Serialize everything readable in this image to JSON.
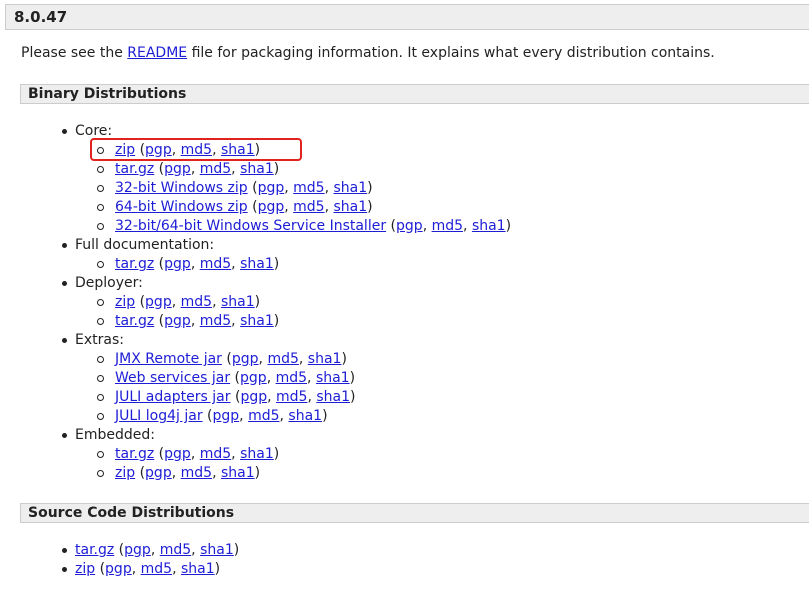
{
  "version": "8.0.47",
  "intro": {
    "prefix": "Please see the ",
    "readme_link": "README",
    "suffix": " file for packaging information. It explains what every distribution contains."
  },
  "binary": {
    "title": "Binary Distributions",
    "groups": [
      {
        "label": "Core:",
        "items": [
          {
            "name": "zip",
            "pgp": "pgp",
            "md5": "md5",
            "sha1": "sha1"
          },
          {
            "name": "tar.gz",
            "pgp": "pgp",
            "md5": "md5",
            "sha1": "sha1"
          },
          {
            "name": "32-bit Windows zip",
            "pgp": "pgp",
            "md5": "md5",
            "sha1": "sha1"
          },
          {
            "name": "64-bit Windows zip",
            "pgp": "pgp",
            "md5": "md5",
            "sha1": "sha1"
          },
          {
            "name": "32-bit/64-bit Windows Service Installer",
            "pgp": "pgp",
            "md5": "md5",
            "sha1": "sha1"
          }
        ]
      },
      {
        "label": "Full documentation:",
        "items": [
          {
            "name": "tar.gz",
            "pgp": "pgp",
            "md5": "md5",
            "sha1": "sha1"
          }
        ]
      },
      {
        "label": "Deployer:",
        "items": [
          {
            "name": "zip",
            "pgp": "pgp",
            "md5": "md5",
            "sha1": "sha1"
          },
          {
            "name": "tar.gz",
            "pgp": "pgp",
            "md5": "md5",
            "sha1": "sha1"
          }
        ]
      },
      {
        "label": "Extras:",
        "items": [
          {
            "name": "JMX Remote jar",
            "pgp": "pgp",
            "md5": "md5",
            "sha1": "sha1"
          },
          {
            "name": "Web services jar",
            "pgp": "pgp",
            "md5": "md5",
            "sha1": "sha1"
          },
          {
            "name": "JULI adapters jar",
            "pgp": "pgp",
            "md5": "md5",
            "sha1": "sha1"
          },
          {
            "name": "JULI log4j jar",
            "pgp": "pgp",
            "md5": "md5",
            "sha1": "sha1"
          }
        ]
      },
      {
        "label": "Embedded:",
        "items": [
          {
            "name": "tar.gz",
            "pgp": "pgp",
            "md5": "md5",
            "sha1": "sha1"
          },
          {
            "name": "zip",
            "pgp": "pgp",
            "md5": "md5",
            "sha1": "sha1"
          }
        ]
      }
    ]
  },
  "source": {
    "title": "Source Code Distributions",
    "items": [
      {
        "name": "tar.gz",
        "pgp": "pgp",
        "md5": "md5",
        "sha1": "sha1"
      },
      {
        "name": "zip",
        "pgp": "pgp",
        "md5": "md5",
        "sha1": "sha1"
      }
    ]
  },
  "highlight_color": "#e0231c",
  "link_color": "#1d1dd6"
}
